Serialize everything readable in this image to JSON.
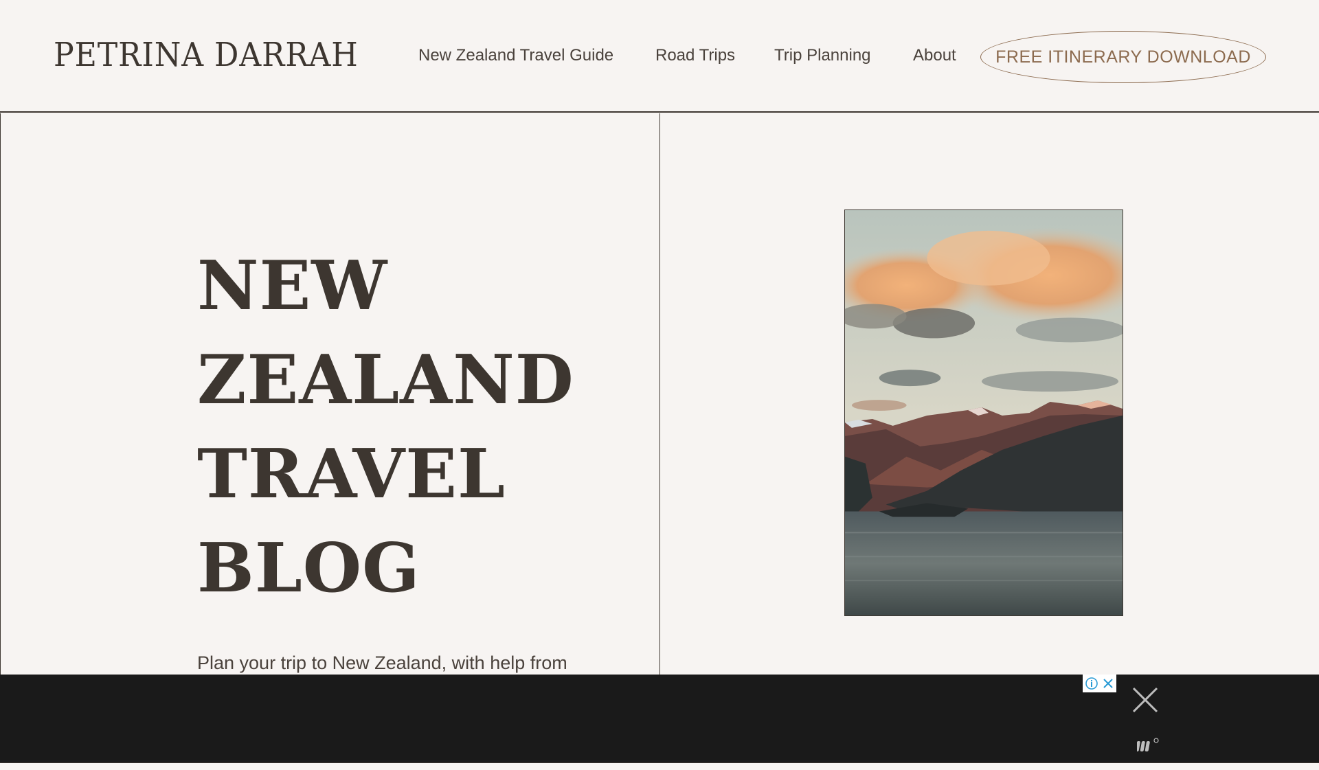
{
  "header": {
    "logo": "PETRINA DARRAH",
    "nav": [
      {
        "label": "New Zealand Travel Guide"
      },
      {
        "label": "Road Trips"
      },
      {
        "label": "Trip Planning"
      },
      {
        "label": "About"
      }
    ],
    "cta_label": "FREE ITINERARY DOWNLOAD"
  },
  "hero": {
    "title_lines": [
      "NEW",
      "ZEALAND",
      "TRAVEL",
      "BLOG"
    ],
    "subtitle": "Plan your trip to New Zealand, with help from a local"
  },
  "ad": {
    "choices_icons": [
      "info-icon",
      "close-icon"
    ],
    "close_icon": "close-x-icon"
  },
  "colors": {
    "background": "#f7f4f2",
    "text": "#3d3630",
    "accent": "#8c6b4f",
    "ad_bar": "#1a1a1a"
  }
}
